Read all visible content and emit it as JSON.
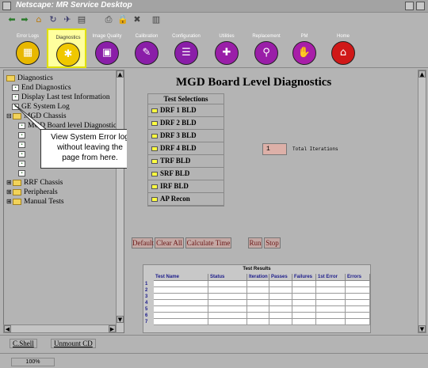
{
  "window": {
    "title": "Netscape: MR Service Desktop"
  },
  "modules": [
    {
      "label": "Error Logs",
      "icon": "error-logs-icon",
      "color": "#e8b800",
      "glyph": "▦"
    },
    {
      "label": "Diagnostics",
      "icon": "diagnostics-icon",
      "color": "#f0c800",
      "glyph": "✱"
    },
    {
      "label": "Image Quality",
      "icon": "image-quality-icon",
      "color": "#8a1ea8",
      "glyph": "▣"
    },
    {
      "label": "Calibration",
      "icon": "calibration-icon",
      "color": "#8a1ea8",
      "glyph": "✎"
    },
    {
      "label": "Configuration",
      "icon": "configuration-icon",
      "color": "#8a1ea8",
      "glyph": "☰"
    },
    {
      "label": "Utilities",
      "icon": "utilities-icon",
      "color": "#9a1ea8",
      "glyph": "✚"
    },
    {
      "label": "Replacement",
      "icon": "replacement-icon",
      "color": "#9a1ea8",
      "glyph": "⚲"
    },
    {
      "label": "PM",
      "icon": "pm-icon",
      "color": "#a81ea8",
      "glyph": "✋"
    },
    {
      "label": "Home",
      "icon": "home-icon",
      "color": "#d01818",
      "glyph": "⌂"
    }
  ],
  "tree": [
    {
      "label": "Diagnostics",
      "type": "folder"
    },
    {
      "label": "End Diagnostics",
      "type": "item"
    },
    {
      "label": "Display Last test Information",
      "type": "item"
    },
    {
      "label": "GE System Log",
      "type": "item"
    },
    {
      "label": "MGD Chassis",
      "type": "folder"
    },
    {
      "label": "MGD Board level Diagnostics",
      "type": "item"
    },
    {
      "label": "RRF Chassis",
      "type": "folder"
    },
    {
      "label": "Peripherals",
      "type": "folder"
    },
    {
      "label": "Manual Tests",
      "type": "folder"
    }
  ],
  "callout": {
    "line1": "View System Error log",
    "line2": "without leaving the",
    "line3": "page from here."
  },
  "main": {
    "title": "MGD Board Level Diagnostics",
    "test_selections_header": "Test Selections",
    "tests": [
      "DRF 1 BLD",
      "DRF 2 BLD",
      "DRF 3 BLD",
      "DRF 4 BLD",
      "TRF  BLD",
      "SRF  BLD",
      "IRF  BLD",
      "AP Recon"
    ],
    "iterations_value": "1",
    "iterations_label": "Total Iterations"
  },
  "buttons": {
    "default": "Default",
    "clear_all": "Clear All",
    "calculate_time": "Calculate Time",
    "run": "Run",
    "stop": "Stop"
  },
  "results": {
    "title": "Test Results",
    "columns": [
      "Test Name",
      "Status",
      "Iteration",
      "Passes",
      "Failures",
      "1st Error",
      "Errors"
    ],
    "rows": [
      "1",
      "2",
      "3",
      "4",
      "5",
      "6",
      "7"
    ]
  },
  "status": {
    "cshell": "C.Shell",
    "unmount_cd": "Unmount CD",
    "zoom": "100%"
  }
}
